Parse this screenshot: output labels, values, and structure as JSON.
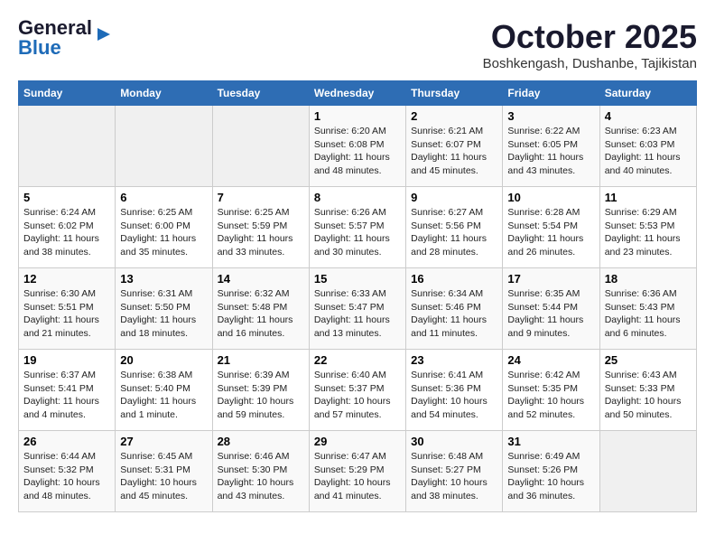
{
  "header": {
    "logo_general": "General",
    "logo_blue": "Blue",
    "month": "October 2025",
    "location": "Boshkengash, Dushanbe, Tajikistan"
  },
  "weekdays": [
    "Sunday",
    "Monday",
    "Tuesday",
    "Wednesday",
    "Thursday",
    "Friday",
    "Saturday"
  ],
  "weeks": [
    [
      {
        "day": "",
        "info": ""
      },
      {
        "day": "",
        "info": ""
      },
      {
        "day": "",
        "info": ""
      },
      {
        "day": "1",
        "info": "Sunrise: 6:20 AM\nSunset: 6:08 PM\nDaylight: 11 hours and 48 minutes."
      },
      {
        "day": "2",
        "info": "Sunrise: 6:21 AM\nSunset: 6:07 PM\nDaylight: 11 hours and 45 minutes."
      },
      {
        "day": "3",
        "info": "Sunrise: 6:22 AM\nSunset: 6:05 PM\nDaylight: 11 hours and 43 minutes."
      },
      {
        "day": "4",
        "info": "Sunrise: 6:23 AM\nSunset: 6:03 PM\nDaylight: 11 hours and 40 minutes."
      }
    ],
    [
      {
        "day": "5",
        "info": "Sunrise: 6:24 AM\nSunset: 6:02 PM\nDaylight: 11 hours and 38 minutes."
      },
      {
        "day": "6",
        "info": "Sunrise: 6:25 AM\nSunset: 6:00 PM\nDaylight: 11 hours and 35 minutes."
      },
      {
        "day": "7",
        "info": "Sunrise: 6:25 AM\nSunset: 5:59 PM\nDaylight: 11 hours and 33 minutes."
      },
      {
        "day": "8",
        "info": "Sunrise: 6:26 AM\nSunset: 5:57 PM\nDaylight: 11 hours and 30 minutes."
      },
      {
        "day": "9",
        "info": "Sunrise: 6:27 AM\nSunset: 5:56 PM\nDaylight: 11 hours and 28 minutes."
      },
      {
        "day": "10",
        "info": "Sunrise: 6:28 AM\nSunset: 5:54 PM\nDaylight: 11 hours and 26 minutes."
      },
      {
        "day": "11",
        "info": "Sunrise: 6:29 AM\nSunset: 5:53 PM\nDaylight: 11 hours and 23 minutes."
      }
    ],
    [
      {
        "day": "12",
        "info": "Sunrise: 6:30 AM\nSunset: 5:51 PM\nDaylight: 11 hours and 21 minutes."
      },
      {
        "day": "13",
        "info": "Sunrise: 6:31 AM\nSunset: 5:50 PM\nDaylight: 11 hours and 18 minutes."
      },
      {
        "day": "14",
        "info": "Sunrise: 6:32 AM\nSunset: 5:48 PM\nDaylight: 11 hours and 16 minutes."
      },
      {
        "day": "15",
        "info": "Sunrise: 6:33 AM\nSunset: 5:47 PM\nDaylight: 11 hours and 13 minutes."
      },
      {
        "day": "16",
        "info": "Sunrise: 6:34 AM\nSunset: 5:46 PM\nDaylight: 11 hours and 11 minutes."
      },
      {
        "day": "17",
        "info": "Sunrise: 6:35 AM\nSunset: 5:44 PM\nDaylight: 11 hours and 9 minutes."
      },
      {
        "day": "18",
        "info": "Sunrise: 6:36 AM\nSunset: 5:43 PM\nDaylight: 11 hours and 6 minutes."
      }
    ],
    [
      {
        "day": "19",
        "info": "Sunrise: 6:37 AM\nSunset: 5:41 PM\nDaylight: 11 hours and 4 minutes."
      },
      {
        "day": "20",
        "info": "Sunrise: 6:38 AM\nSunset: 5:40 PM\nDaylight: 11 hours and 1 minute."
      },
      {
        "day": "21",
        "info": "Sunrise: 6:39 AM\nSunset: 5:39 PM\nDaylight: 10 hours and 59 minutes."
      },
      {
        "day": "22",
        "info": "Sunrise: 6:40 AM\nSunset: 5:37 PM\nDaylight: 10 hours and 57 minutes."
      },
      {
        "day": "23",
        "info": "Sunrise: 6:41 AM\nSunset: 5:36 PM\nDaylight: 10 hours and 54 minutes."
      },
      {
        "day": "24",
        "info": "Sunrise: 6:42 AM\nSunset: 5:35 PM\nDaylight: 10 hours and 52 minutes."
      },
      {
        "day": "25",
        "info": "Sunrise: 6:43 AM\nSunset: 5:33 PM\nDaylight: 10 hours and 50 minutes."
      }
    ],
    [
      {
        "day": "26",
        "info": "Sunrise: 6:44 AM\nSunset: 5:32 PM\nDaylight: 10 hours and 48 minutes."
      },
      {
        "day": "27",
        "info": "Sunrise: 6:45 AM\nSunset: 5:31 PM\nDaylight: 10 hours and 45 minutes."
      },
      {
        "day": "28",
        "info": "Sunrise: 6:46 AM\nSunset: 5:30 PM\nDaylight: 10 hours and 43 minutes."
      },
      {
        "day": "29",
        "info": "Sunrise: 6:47 AM\nSunset: 5:29 PM\nDaylight: 10 hours and 41 minutes."
      },
      {
        "day": "30",
        "info": "Sunrise: 6:48 AM\nSunset: 5:27 PM\nDaylight: 10 hours and 38 minutes."
      },
      {
        "day": "31",
        "info": "Sunrise: 6:49 AM\nSunset: 5:26 PM\nDaylight: 10 hours and 36 minutes."
      },
      {
        "day": "",
        "info": ""
      }
    ]
  ]
}
